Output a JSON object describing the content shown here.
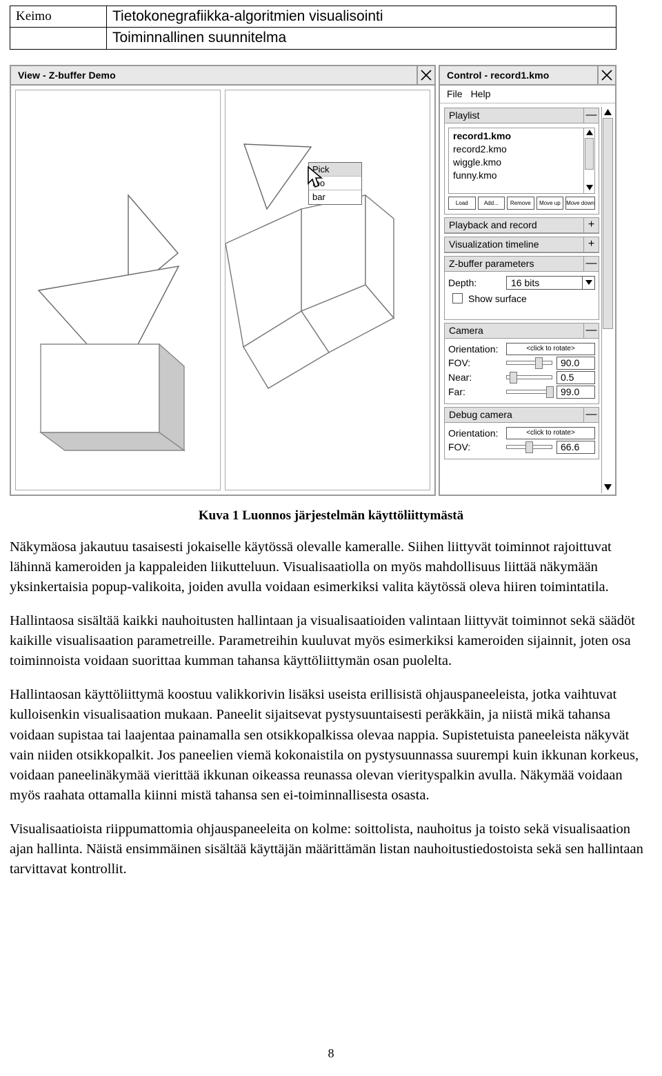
{
  "header": {
    "product": "Keimo",
    "title": "Tietokonegrafiikka-algoritmien visualisointi",
    "subtitle": "Toiminnallinen suunnitelma"
  },
  "view_window": {
    "title": "View - Z-buffer Demo",
    "close_icon": "close-icon",
    "popup_menu": {
      "items": [
        {
          "label": "Pick",
          "highlighted": true
        },
        {
          "label": "foo",
          "highlighted": false
        },
        {
          "label": "bar",
          "highlighted": false
        }
      ]
    }
  },
  "control_window": {
    "title": "Control - record1.kmo",
    "close_icon": "close-icon",
    "menubar": [
      "File",
      "Help"
    ],
    "panels": [
      {
        "title": "Playlist",
        "toggle": "—",
        "expanded": true,
        "items": [
          "record1.kmo",
          "record2.kmo",
          "wiggle.kmo",
          "funny.kmo"
        ],
        "selected": "record1.kmo",
        "buttons": [
          "Load",
          "Add...",
          "Remove",
          "Move up",
          "Move down"
        ]
      },
      {
        "title": "Playback and record",
        "toggle": "+",
        "expanded": false
      },
      {
        "title": "Visualization timeline",
        "toggle": "+",
        "expanded": false
      },
      {
        "title": "Z-buffer parameters",
        "toggle": "—",
        "expanded": true,
        "depth_label": "Depth:",
        "depth_value": "16 bits",
        "show_surface_label": "Show surface",
        "show_surface_checked": false
      },
      {
        "title": "Camera",
        "toggle": "—",
        "expanded": true,
        "orientation_label": "Orientation:",
        "orientation_value": "<click to rotate>",
        "sliders": [
          {
            "label": "FOV:",
            "value": "90.0",
            "pos": 65
          },
          {
            "label": "Near:",
            "value": "0.5",
            "pos": 12
          },
          {
            "label": "Far:",
            "value": "99.0",
            "pos": 88
          }
        ]
      },
      {
        "title": "Debug camera",
        "toggle": "—",
        "expanded": true,
        "orientation_label": "Orientation:",
        "orientation_value": "<click to rotate>",
        "sliders": [
          {
            "label": "FOV:",
            "value": "66.6",
            "pos": 45
          }
        ]
      }
    ]
  },
  "caption": "Kuva 1 Luonnos järjestelmän käyttöliittymästä",
  "paragraphs": [
    "Näkymäosa jakautuu tasaisesti jokaiselle käytössä olevalle kameralle. Siihen liittyvät toiminnot rajoittuvat lähinnä kameroiden ja kappaleiden liikutteluun. Visualisaatiolla on myös mahdollisuus liittää näkymään yksinkertaisia popup-valikoita, joiden avulla voidaan esimerkiksi valita käytössä oleva hiiren toimintatila.",
    "Hallintaosa sisältää kaikki nauhoitusten hallintaan ja visualisaatioiden valintaan liittyvät toiminnot sekä säädöt kaikille visualisaation parametreille. Parametreihin kuuluvat myös esimerkiksi kameroiden sijainnit, joten osa toiminnoista voidaan suorittaa kumman tahansa käyttöliittymän osan puolelta.",
    "Hallintaosan käyttöliittymä koostuu valikkorivin lisäksi useista erillisistä ohjauspaneeleista, jotka vaihtuvat kulloisenkin visualisaation mukaan. Paneelit sijaitsevat pystysuuntaisesti peräkkäin, ja niistä mikä tahansa voidaan supistaa tai laajentaa painamalla sen otsikkopalkissa olevaa nappia. Supistetuista paneeleista näkyvät vain niiden otsikkopalkit. Jos paneelien viemä kokonaistila on pystysuunnassa suurempi kuin ikkunan korkeus, voidaan paneelinäkymää vierittää ikkunan oikeassa reunassa olevan vierityspalkin avulla. Näkymää voidaan myös raahata ottamalla kiinni mistä tahansa sen ei-toiminnallisesta osasta.",
    "Visualisaatioista riippumattomia ohjauspaneeleita on kolme: soittolista, nauhoitus ja toisto sekä visualisaation ajan hallinta. Näistä ensimmäinen sisältää käyttäjän määrittämän listan nauhoitustiedostoista sekä sen hallintaan tarvittavat kontrollit."
  ],
  "page_number": "8"
}
